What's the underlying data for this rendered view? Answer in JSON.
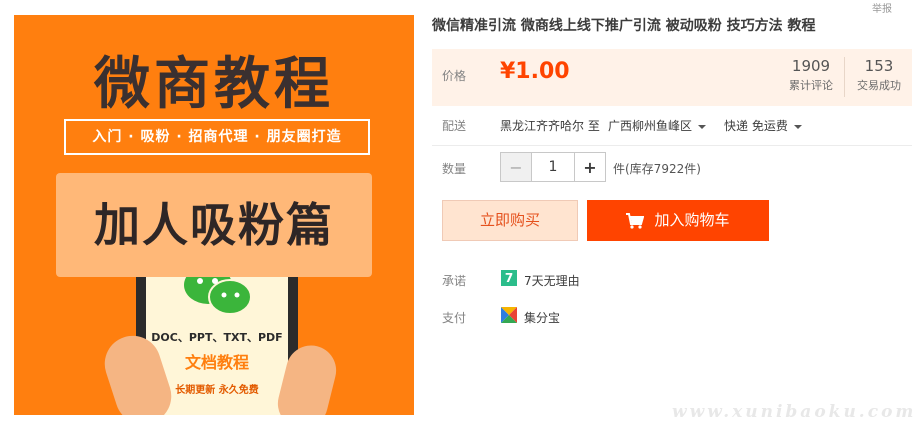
{
  "product_image": {
    "title": "微商教程",
    "subtitle": "入门 · 吸粉 · 招商代理 · 朋友圈打造",
    "banner": "加人吸粉篇",
    "doc_types": "DOC、PPT、TXT、PDF",
    "doc_label": "文档教程",
    "update_note": "长期更新 永久免费"
  },
  "product": {
    "title": "微信精准引流 微商线上线下推广引流 被动吸粉 技巧方法 教程",
    "corner_text": "举报"
  },
  "price": {
    "label": "价格",
    "value": "¥1.00",
    "color": "#ff4400"
  },
  "stats": {
    "reviews_count": "1909",
    "reviews_label": "累计评论",
    "sales_count": "153",
    "sales_label": "交易成功"
  },
  "delivery": {
    "label": "配送",
    "from": "黑龙江齐齐哈尔 至",
    "to": "广西柳州鱼峰区",
    "method": "快递 免运费"
  },
  "quantity": {
    "label": "数量",
    "value": "1",
    "minus": "−",
    "plus": "+",
    "stock": "件(库存7922件)"
  },
  "actions": {
    "buy_now": "立即购买",
    "add_to_cart": "加入购物车",
    "cart_icon": "shopping-cart-icon"
  },
  "promise": {
    "label": "承诺",
    "icon_text": "7",
    "text": "7天无理由"
  },
  "payment": {
    "label": "支付",
    "text": "集分宝"
  },
  "watermark": "www.xunibaoku.com"
}
